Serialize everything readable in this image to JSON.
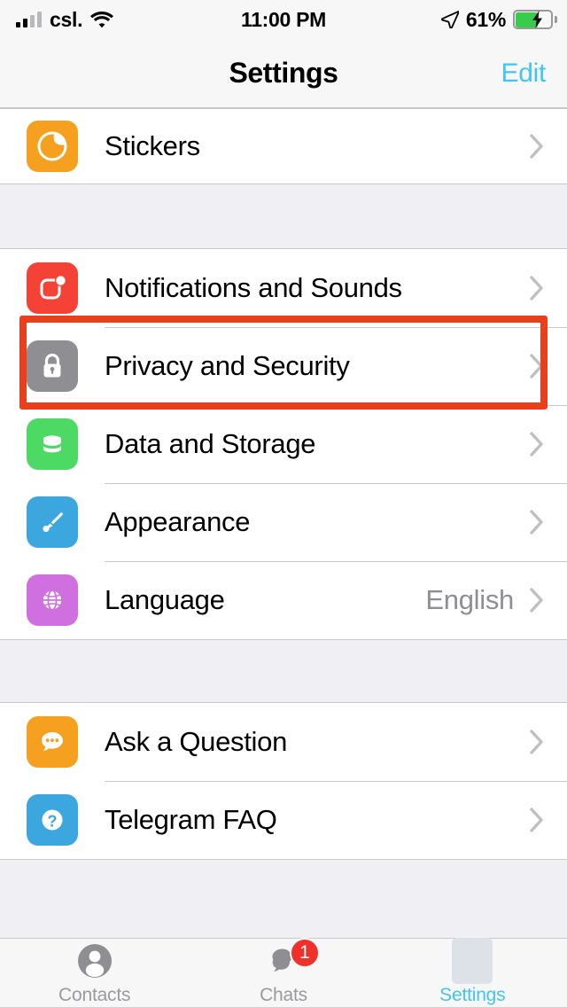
{
  "status_bar": {
    "carrier": "csl.",
    "time": "11:00 PM",
    "battery_percent": "61%",
    "signal_bars_filled": 2,
    "signal_bars_total": 4,
    "wifi_icon": "wifi-icon",
    "location_icon": "location-arrow-icon",
    "battery_icon": "battery-charging-icon",
    "battery_level": 61,
    "charging": true
  },
  "nav": {
    "title": "Settings",
    "edit_label": "Edit",
    "edit_color": "#41C6F2"
  },
  "groups": [
    {
      "id": "group-media",
      "rows": [
        {
          "id": "stickers",
          "label": "Stickers",
          "icon": "stickers-icon",
          "icon_color": "#F5A01E",
          "value": "",
          "chevron": true
        }
      ]
    },
    {
      "id": "group-settings",
      "rows": [
        {
          "id": "notifications-and-sounds",
          "label": "Notifications and Sounds",
          "icon": "notifications-icon",
          "icon_color": "#F44336",
          "value": "",
          "chevron": true
        },
        {
          "id": "privacy-and-security",
          "label": "Privacy and Security",
          "icon": "lock-icon",
          "icon_color": "#8E8E93",
          "value": "",
          "chevron": true,
          "highlighted": true
        },
        {
          "id": "data-and-storage",
          "label": "Data and Storage",
          "icon": "database-icon",
          "icon_color": "#4CD964",
          "value": "",
          "chevron": true
        },
        {
          "id": "appearance",
          "label": "Appearance",
          "icon": "paintbrush-icon",
          "icon_color": "#3BA7DE",
          "value": "",
          "chevron": true
        },
        {
          "id": "language",
          "label": "Language",
          "icon": "globe-icon",
          "icon_color": "#D06FE0",
          "value": "English",
          "chevron": true
        }
      ]
    },
    {
      "id": "group-help",
      "rows": [
        {
          "id": "ask-a-question",
          "label": "Ask a Question",
          "icon": "chat-bubble-icon",
          "icon_color": "#F5A01E",
          "value": "",
          "chevron": true
        },
        {
          "id": "telegram-faq",
          "label": "Telegram FAQ",
          "icon": "question-mark-icon",
          "icon_color": "#3BA7DE",
          "value": "",
          "chevron": true
        }
      ]
    }
  ],
  "annotation": {
    "target": "Privacy and Security",
    "color": "#E8401C",
    "shape": "rectangle"
  },
  "tab_bar": {
    "tabs": [
      {
        "id": "contacts",
        "label": "Contacts",
        "icon": "person-icon",
        "active": false,
        "badge": ""
      },
      {
        "id": "chats",
        "label": "Chats",
        "icon": "chat-bubbles-icon",
        "active": false,
        "badge": "1"
      },
      {
        "id": "settings",
        "label": "Settings",
        "icon": "settings-placeholder-icon",
        "active": true,
        "badge": ""
      }
    ],
    "active_color": "#41C6F2",
    "inactive_color": "#9A9A9F",
    "badge_color": "#F03129"
  }
}
